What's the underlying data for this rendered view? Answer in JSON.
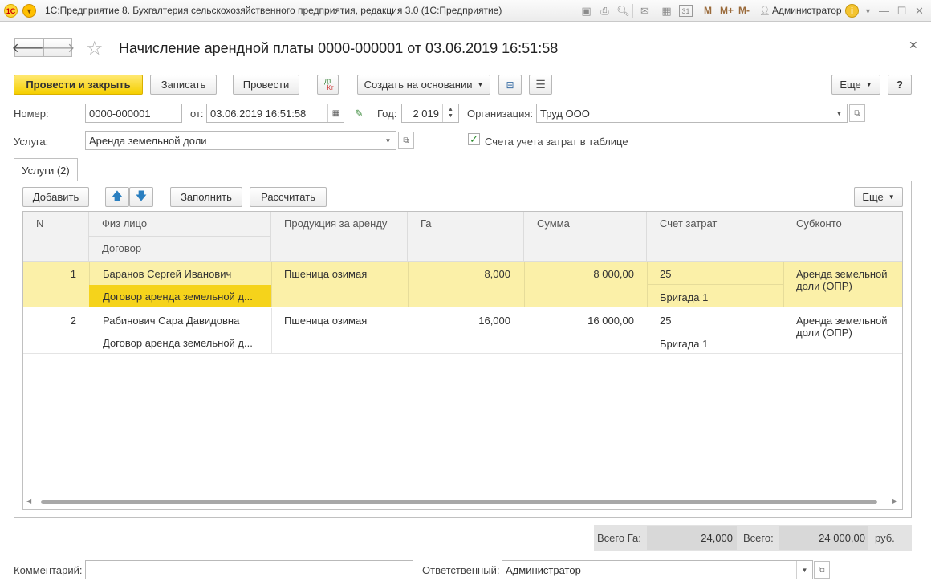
{
  "app": {
    "window_title": "1С:Предприятие 8. Бухгалтерия сельскохозяйственного предприятия, редакция 3.0  (1С:Предприятие)",
    "logo_text": "1С",
    "user": "Администратор",
    "m_buttons": [
      "M",
      "M+",
      "M-"
    ],
    "calendar_day": "31"
  },
  "document": {
    "title": "Начисление арендной платы 0000-000001 от 03.06.2019 16:51:58"
  },
  "toolbar": {
    "post_close": "Провести и закрыть",
    "save": "Записать",
    "post": "Провести",
    "dtkt_top": "Дт",
    "dtkt_bottom": "Кт",
    "create_based": "Создать на основании",
    "more": "Еще",
    "help": "?"
  },
  "header": {
    "number_label": "Номер:",
    "number_value": "0000-000001",
    "date_label": "от:",
    "date_value": "03.06.2019 16:51:58",
    "year_label": "Год:",
    "year_value": "2 019",
    "org_label": "Организация:",
    "org_value": "Труд ООО",
    "service_label": "Услуга:",
    "service_value": "Аренда земельной доли",
    "checkbox_label": "Счета учета затрат в таблице",
    "checkbox_checked": true
  },
  "tabs": [
    {
      "label": "Услуги (2)"
    }
  ],
  "table_toolbar": {
    "add": "Добавить",
    "fill": "Заполнить",
    "calculate": "Рассчитать",
    "more": "Еще"
  },
  "table": {
    "headers": {
      "n": "N",
      "person": "Физ лицо",
      "contract": "Договор",
      "product": "Продукция за аренду",
      "ha": "Га",
      "sum": "Сумма",
      "account": "Счет затрат",
      "subconto": "Субконто"
    },
    "rows": [
      {
        "n": "1",
        "person": "Баранов Сергей Иванович",
        "contract": "Договор аренда земельной д...",
        "product": "Пшеница озимая",
        "ha": "8,000",
        "sum": "8 000,00",
        "account": "25",
        "subaccount": "Бригада 1",
        "subconto_1": "Аренда земельной",
        "subconto_2": "доли (ОПР)"
      },
      {
        "n": "2",
        "person": "Рабинович Сара Давидовна",
        "contract": "Договор аренда земельной д...",
        "product": "Пшеница озимая",
        "ha": "16,000",
        "sum": "16 000,00",
        "account": "25",
        "subaccount": "Бригада 1",
        "subconto_1": "Аренда земельной",
        "subconto_2": "доли (ОПР)"
      }
    ]
  },
  "totals": {
    "ha_label": "Всего Га:",
    "ha_value": "24,000",
    "total_label": "Всего:",
    "total_value": "24 000,00",
    "currency": "руб."
  },
  "footer": {
    "comment_label": "Комментарий:",
    "comment_value": "",
    "responsible_label": "Ответственный:",
    "responsible_value": "Администратор"
  },
  "colors": {
    "primary_button": "#f5cf00",
    "selected_row": "#fbf0a8",
    "selected_cell": "#f5d31b"
  }
}
